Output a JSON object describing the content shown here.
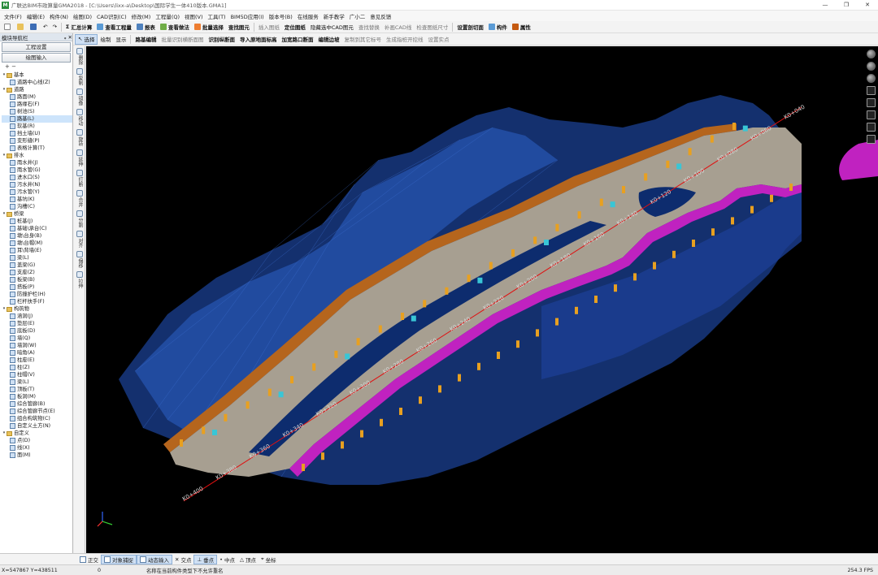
{
  "titlebar": {
    "logo": "M",
    "title": "广联达BIM市政算量GMA2018 - [C:\\Users\\lixx-a\\Desktop\\国际学生一体410版本.GMA1]",
    "controls": [
      "—",
      "❐",
      "✕"
    ]
  },
  "menu": [
    "文件(F)",
    "编辑(E)",
    "构件(N)",
    "绘图(D)",
    "CAD识别(C)",
    "修改(M)",
    "工程量(Q)",
    "视图(V)",
    "工具(T)",
    "BIM5D应用(I)",
    "版本号(B)",
    "在线服务",
    "新手教学",
    "广小二",
    "意见反馈"
  ],
  "toolbar1": {
    "summary": "汇总计算",
    "check_qty": "查看工程量",
    "report": "报表",
    "query_method": "查看做法",
    "batch_select": "批量选择",
    "find_element": "查找图元",
    "insert_drawing": "插入图纸",
    "locate_drawing": "定位图纸",
    "hide_cad": "隐藏选中CAD图元",
    "find_replace": "查找替换",
    "fill_cad": "补画CAD线",
    "check_size": "检查图纸尺寸",
    "set_cut": "设置剖切面",
    "element": "构件",
    "property": "属性"
  },
  "toolbar2": {
    "select": "选择",
    "draw": "绘制",
    "display": "显示",
    "route_edit": "路基编辑",
    "batch_gen": "批量识别横断面图",
    "identify_cross": "识别纵断面",
    "import_terrain": "导入原地面标高",
    "add_intersection": "加宽路口断面",
    "edit_edge": "编辑边坡",
    "copy_other": "复制到其它标号",
    "gen_stake": "生成指桩开挖线",
    "set_start": "设置实点"
  },
  "nav": {
    "header": "模块导航栏",
    "pin": "ᵩ ✕",
    "btn_settings": "工程设置",
    "btn_draw_input": "绘图输入",
    "tree": [
      {
        "label": "基本",
        "level": 0,
        "folder": true
      },
      {
        "label": "道路中心线(Z)",
        "level": 1
      },
      {
        "label": "道路",
        "level": 0,
        "folder": true
      },
      {
        "label": "路面(M)",
        "level": 1
      },
      {
        "label": "路缘石(F)",
        "level": 1
      },
      {
        "label": "树池(S)",
        "level": 1
      },
      {
        "label": "路基(L)",
        "level": 1,
        "selected": true
      },
      {
        "label": "软基(R)",
        "level": 1
      },
      {
        "label": "挡土墙(U)",
        "level": 1
      },
      {
        "label": "变形缝(P)",
        "level": 1
      },
      {
        "label": "表格计算(T)",
        "level": 1
      },
      {
        "label": "排水",
        "level": 0,
        "folder": true
      },
      {
        "label": "雨水井(J)",
        "level": 1
      },
      {
        "label": "雨水管(G)",
        "level": 1
      },
      {
        "label": "进水口(S)",
        "level": 1
      },
      {
        "label": "污水井(N)",
        "level": 1
      },
      {
        "label": "污水管(Y)",
        "level": 1
      },
      {
        "label": "基坑(K)",
        "level": 1
      },
      {
        "label": "沟槽(C)",
        "level": 1
      },
      {
        "label": "桥梁",
        "level": 0,
        "folder": true
      },
      {
        "label": "桩基(J)",
        "level": 1
      },
      {
        "label": "基础\\承台(C)",
        "level": 1
      },
      {
        "label": "墩\\台身(B)",
        "level": 1
      },
      {
        "label": "墩\\台帽(M)",
        "level": 1
      },
      {
        "label": "耳\\背墙(E)",
        "level": 1
      },
      {
        "label": "梁(L)",
        "level": 1
      },
      {
        "label": "盖梁(G)",
        "level": 1
      },
      {
        "label": "支座(Z)",
        "level": 1
      },
      {
        "label": "板梁(B)",
        "level": 1
      },
      {
        "label": "搭板(P)",
        "level": 1
      },
      {
        "label": "防撞护栏(H)",
        "level": 1
      },
      {
        "label": "栏杆扶手(F)",
        "level": 1
      },
      {
        "label": "构筑物",
        "level": 0,
        "folder": true
      },
      {
        "label": "涵洞(J)",
        "level": 1
      },
      {
        "label": "垫层(E)",
        "level": 1
      },
      {
        "label": "底板(D)",
        "level": 1
      },
      {
        "label": "墙(Q)",
        "level": 1
      },
      {
        "label": "墙洞(W)",
        "level": 1
      },
      {
        "label": "暗角(A)",
        "level": 1
      },
      {
        "label": "柱座(E)",
        "level": 1
      },
      {
        "label": "柱(Z)",
        "level": 1
      },
      {
        "label": "柱帽(V)",
        "level": 1
      },
      {
        "label": "梁(L)",
        "level": 1
      },
      {
        "label": "顶板(T)",
        "level": 1
      },
      {
        "label": "板洞(M)",
        "level": 1
      },
      {
        "label": "综合管廊(B)",
        "level": 1
      },
      {
        "label": "综合管廊节点(E)",
        "level": 1
      },
      {
        "label": "组合构筑物(C)",
        "level": 1
      },
      {
        "label": "自定义土方(N)",
        "level": 1
      },
      {
        "label": "自定义",
        "level": 0,
        "folder": true
      },
      {
        "label": "点(D)",
        "level": 1
      },
      {
        "label": "线(X)",
        "level": 1
      },
      {
        "label": "面(M)",
        "level": 1
      }
    ]
  },
  "vtools": [
    "删除",
    "复制",
    "镜像",
    "移动",
    "旋转",
    "延伸",
    "打断",
    "合并",
    "分割",
    "对齐",
    "偏移",
    "拉伸"
  ],
  "viewport": {
    "stations": [
      "K0+040",
      "K0+060",
      "K0+080",
      "K0+100",
      "K0+120",
      "K0+140",
      "K0+160",
      "K0+180",
      "K0+200",
      "K0+220",
      "K0+240",
      "K0+260",
      "K0+280",
      "K0+300",
      "K0+320",
      "K0+340",
      "K0+360",
      "K0+380",
      "K0+400"
    ]
  },
  "snapbar": [
    "正交",
    "对象捕捉",
    "动态输入",
    "交点",
    "垂点",
    "中点",
    "顶点",
    "坐标"
  ],
  "status": {
    "coords": "X=547867 Y=438511",
    "num": "0",
    "message": "名称在当前构件类型下不允许重名",
    "fps": "254.3 FPS"
  },
  "colors": {
    "viewport_bg": "#000000",
    "terrain": "#1f4fa8",
    "road_surface": "#a79f91",
    "slope_left": "#b5651d",
    "slope_right": "#c022c0",
    "centerline": "#e01010"
  }
}
